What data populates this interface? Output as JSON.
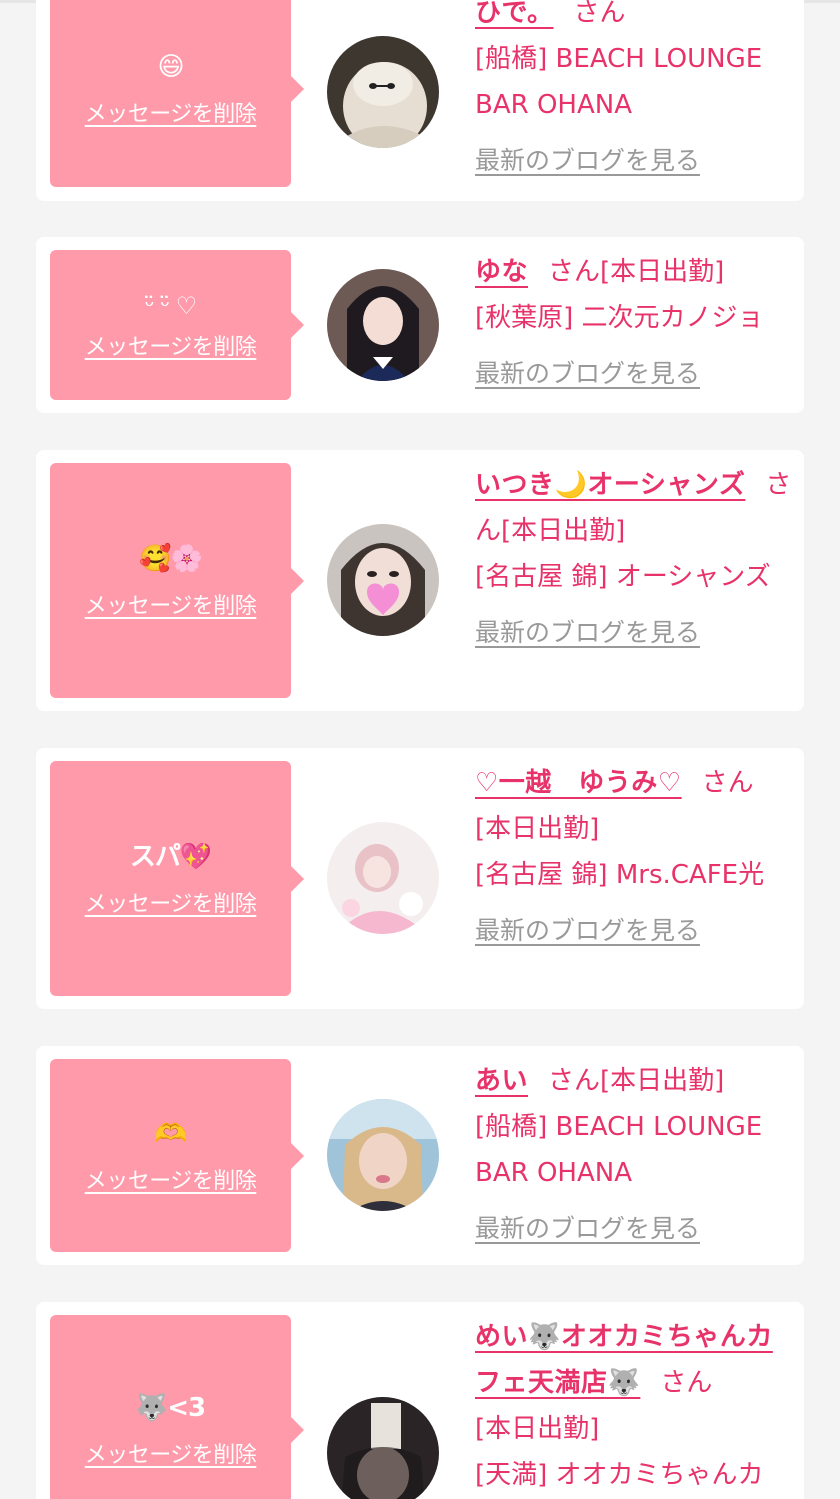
{
  "cards": [
    {
      "message": "😄",
      "delete_label": "メッセージを削除",
      "name": "ひで。",
      "honorific": "さん",
      "status": "",
      "shop": "[船橋] BEACH LOUNGE BAR OHANA",
      "blog_label": "最新のブログを見る"
    },
    {
      "message": "ᵕ̈ ᵕ̈ ♡",
      "delete_label": "メッセージを削除",
      "name": "ゆな",
      "honorific": "さん",
      "status": "[本日出勤]",
      "shop": "[秋葉原] 二次元カノジョ",
      "blog_label": "最新のブログを見る"
    },
    {
      "message": "🥰🌸",
      "delete_label": "メッセージを削除",
      "name": "いつき🌙オーシャンズ",
      "honorific": "さん",
      "status": "[本日出勤]",
      "shop": "[名古屋 錦] オーシャンズ",
      "blog_label": "最新のブログを見る"
    },
    {
      "message": "スパ💖",
      "delete_label": "メッセージを削除",
      "name": "♡一越　ゆうみ♡",
      "honorific": "さん",
      "status": "[本日出勤]",
      "shop": "[名古屋 錦] Mrs.CAFE光",
      "blog_label": "最新のブログを見る"
    },
    {
      "message": "🫶",
      "delete_label": "メッセージを削除",
      "name": "あい",
      "honorific": "さん",
      "status": "[本日出勤]",
      "shop": "[船橋] BEACH LOUNGE BAR OHANA",
      "blog_label": "最新のブログを見る"
    },
    {
      "message": "🐺<3",
      "delete_label": "メッセージを削除",
      "name": "めい🐺オオカミちゃんカフェ天満店🐺",
      "honorific": "さん",
      "status": "[本日出勤]",
      "shop": "[天満] オオカミちゃんカ",
      "blog_label": ""
    }
  ],
  "colors": {
    "accent": "#e8336a",
    "bubble": "#ff9aaa",
    "muted": "#999999",
    "background": "#f4f4f4"
  }
}
